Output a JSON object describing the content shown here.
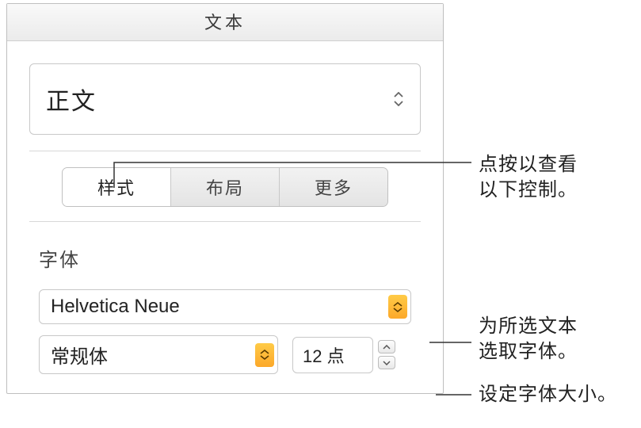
{
  "header": {
    "title": "文本"
  },
  "paragraphStyle": {
    "selected": "正文"
  },
  "tabs": {
    "items": [
      {
        "label": "样式",
        "active": true
      },
      {
        "label": "布局",
        "active": false
      },
      {
        "label": "更多",
        "active": false
      }
    ]
  },
  "font": {
    "sectionLabel": "字体",
    "family": "Helvetica Neue",
    "weight": "常规体",
    "sizeDisplay": "12 点",
    "sizeValue": 12
  },
  "callouts": {
    "tabsHint": "点按以查看\n以下控制。",
    "fontHint": "为所选文本\n选取字体。",
    "sizeHint": "设定字体大小。"
  }
}
